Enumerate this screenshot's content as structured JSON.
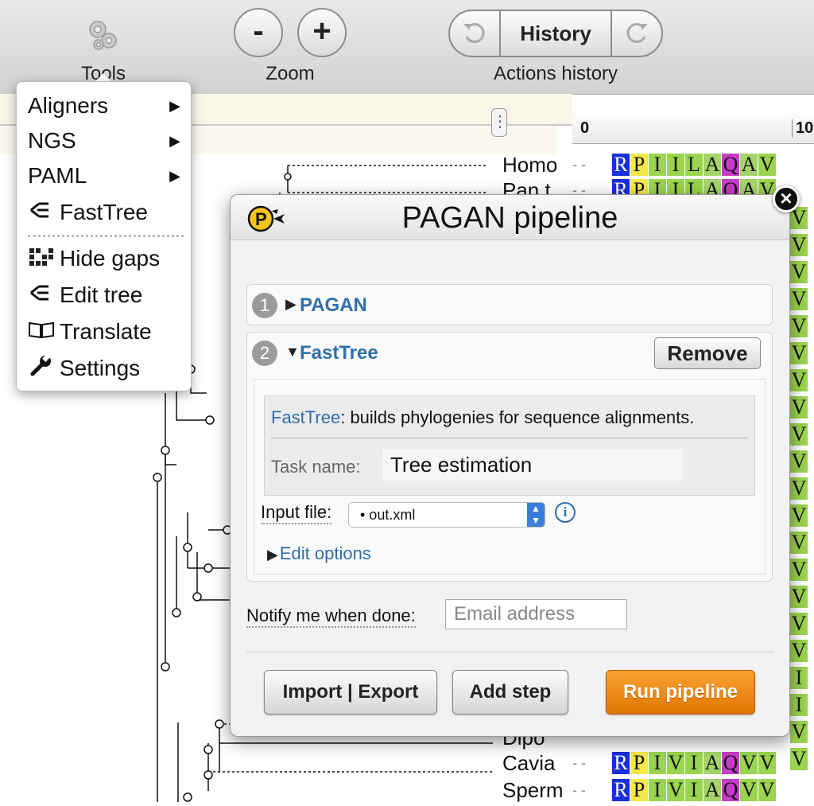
{
  "toolbar": {
    "tools_label": "Tools",
    "zoom_label": "Zoom",
    "zoom_out": "-",
    "zoom_in": "+",
    "history_button": "History",
    "history_label": "Actions history"
  },
  "ruler": {
    "ticks": [
      "0",
      "10"
    ]
  },
  "sequence_names": [
    "Homo",
    "Pan t",
    "Dipo",
    "Cavia",
    "Sperm"
  ],
  "alignment_rows": [
    [
      "R",
      "P",
      "I",
      "I",
      "L",
      "A",
      "Q",
      "A",
      "V"
    ],
    [
      "R",
      "P",
      "I",
      "I",
      "L",
      "A",
      "Q",
      "A",
      "V"
    ],
    [
      "R",
      "P",
      "I",
      "V",
      "I",
      "A",
      "Q",
      "V",
      "V"
    ],
    [
      "R",
      "P",
      "I",
      "V",
      "I",
      "A",
      "Q",
      "V",
      "V"
    ]
  ],
  "alignment_right_column": [
    "V",
    "V",
    "V",
    "V",
    "V",
    "V",
    "V",
    "V",
    "V",
    "V",
    "V",
    "V",
    "V",
    "V",
    "V",
    "V",
    "V",
    "I",
    "I",
    "V",
    "V"
  ],
  "colors": {
    "R": "#1a2fd8",
    "P": "#f5e84a",
    "I": "#9bd44e",
    "L": "#9bd44e",
    "V": "#9bd44e",
    "A": "#a5d36a",
    "Q": "#c63cc8",
    "accent": "#2f6faa",
    "run_button": "#f08a10"
  },
  "tools_menu": {
    "items": [
      {
        "label": "Aligners",
        "submenu": true
      },
      {
        "label": "NGS",
        "submenu": true
      },
      {
        "label": "PAML",
        "submenu": true
      },
      {
        "label": "FastTree",
        "icon": "tree-icon"
      },
      {
        "label": "Hide gaps",
        "icon": "gaps-grid-icon"
      },
      {
        "label": "Edit tree",
        "icon": "tree-icon"
      },
      {
        "label": "Translate",
        "icon": "book-icon"
      },
      {
        "label": "Settings",
        "icon": "wrench-icon"
      }
    ]
  },
  "dialog": {
    "title": "PAGAN pipeline",
    "close": "×",
    "steps": [
      {
        "number": "1",
        "name": "PAGAN"
      },
      {
        "number": "2",
        "name": "FastTree",
        "remove_label": "Remove"
      }
    ],
    "step2": {
      "desc_link": "FastTree",
      "desc_text": ": builds phylogenies for sequence alignments.",
      "task_name_label": "Task name:",
      "task_name_value": "Tree estimation",
      "input_file_label": "Input file:",
      "input_file_value": "• out.xml",
      "info": "i",
      "edit_options": "Edit options"
    },
    "notify_label": "Notify me when done:",
    "email_placeholder": "Email address",
    "buttons": {
      "import_export": "Import | Export",
      "add_step": "Add step",
      "run": "Run pipeline"
    }
  }
}
